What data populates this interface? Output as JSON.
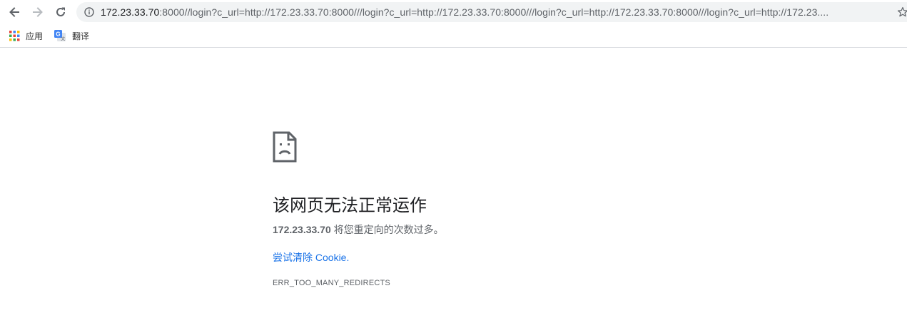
{
  "browser": {
    "url_host": "172.23.33.70",
    "url_rest": ":8000//login?c_url=http://172.23.33.70:8000///login?c_url=http://172.23.33.70:8000///login?c_url=http://172.23.33.70:8000///login?c_url=http://172.23....",
    "icons": {
      "back": "back-arrow-icon",
      "forward": "forward-arrow-icon",
      "reload": "reload-icon",
      "info": "info-icon",
      "star": "star-icon"
    }
  },
  "bookmarks": [
    {
      "label": "应用",
      "icon": "apps-grid-icon"
    },
    {
      "label": "翻译",
      "icon": "google-translate-icon"
    }
  ],
  "error_page": {
    "title": "该网页无法正常运作",
    "host": "172.23.33.70",
    "message": " 将您重定向的次数过多。",
    "link_label": "尝试清除 Cookie.",
    "error_code": "ERR_TOO_MANY_REDIRECTS"
  },
  "colors": {
    "link": "#1a73e8",
    "text_primary": "#202124",
    "text_secondary": "#5f6368",
    "omnibox_bg": "#f1f3f4"
  }
}
